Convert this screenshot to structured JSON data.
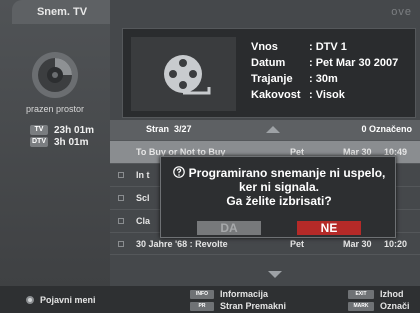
{
  "app": {
    "title": "Snem. TV",
    "brand": "ove"
  },
  "storage": {
    "label": "prazen prostor",
    "items": [
      {
        "badge": "TV",
        "time": "23h 01m"
      },
      {
        "badge": "DTV",
        "time": "3h 01m"
      }
    ]
  },
  "details": {
    "rows": [
      {
        "key": "Vnos",
        "value": ": DTV 1"
      },
      {
        "key": "Datum",
        "value": ": Pet Mar 30 2007"
      },
      {
        "key": "Trajanje",
        "value": ": 30m"
      },
      {
        "key": "Kakovost",
        "value": ": Visok"
      }
    ],
    "thumbnail_icon": "film-reel-icon"
  },
  "list": {
    "page_label": "Stran",
    "page": "3/27",
    "marked": "0 Označeno",
    "rows": [
      {
        "title": "To Buy or Not to Buy",
        "day": "Pet",
        "date": "Mar 30",
        "time": "10:49"
      },
      {
        "title": "In t",
        "day": "",
        "date": "",
        "time": "5"
      },
      {
        "title": "Scl",
        "day": "",
        "date": "",
        "time": "5"
      },
      {
        "title": "Cla",
        "day": "",
        "date": "",
        "time": ""
      },
      {
        "title": "30 Jahre '68 : Revolte",
        "day": "Pet",
        "date": "Mar 30",
        "time": "10:20"
      }
    ]
  },
  "dialog": {
    "line1": "Programirano snemanje ni uspelo,",
    "line2": "ker ni signala.",
    "line3": "Ga želite izbrisati?",
    "yes": "DA",
    "no": "NE"
  },
  "bottom_bar": {
    "menu": "Pojavni meni",
    "info_key": "INFO",
    "info": "Informacija",
    "pr_key": "PR",
    "pages": "Stran Premakni",
    "exit_key": "EXIT",
    "exit": "Izhod",
    "mark_key": "MARK",
    "mark": "Označi"
  },
  "colors": {
    "accent_no": "#b52a28",
    "selected_row": "#8a8d90"
  }
}
